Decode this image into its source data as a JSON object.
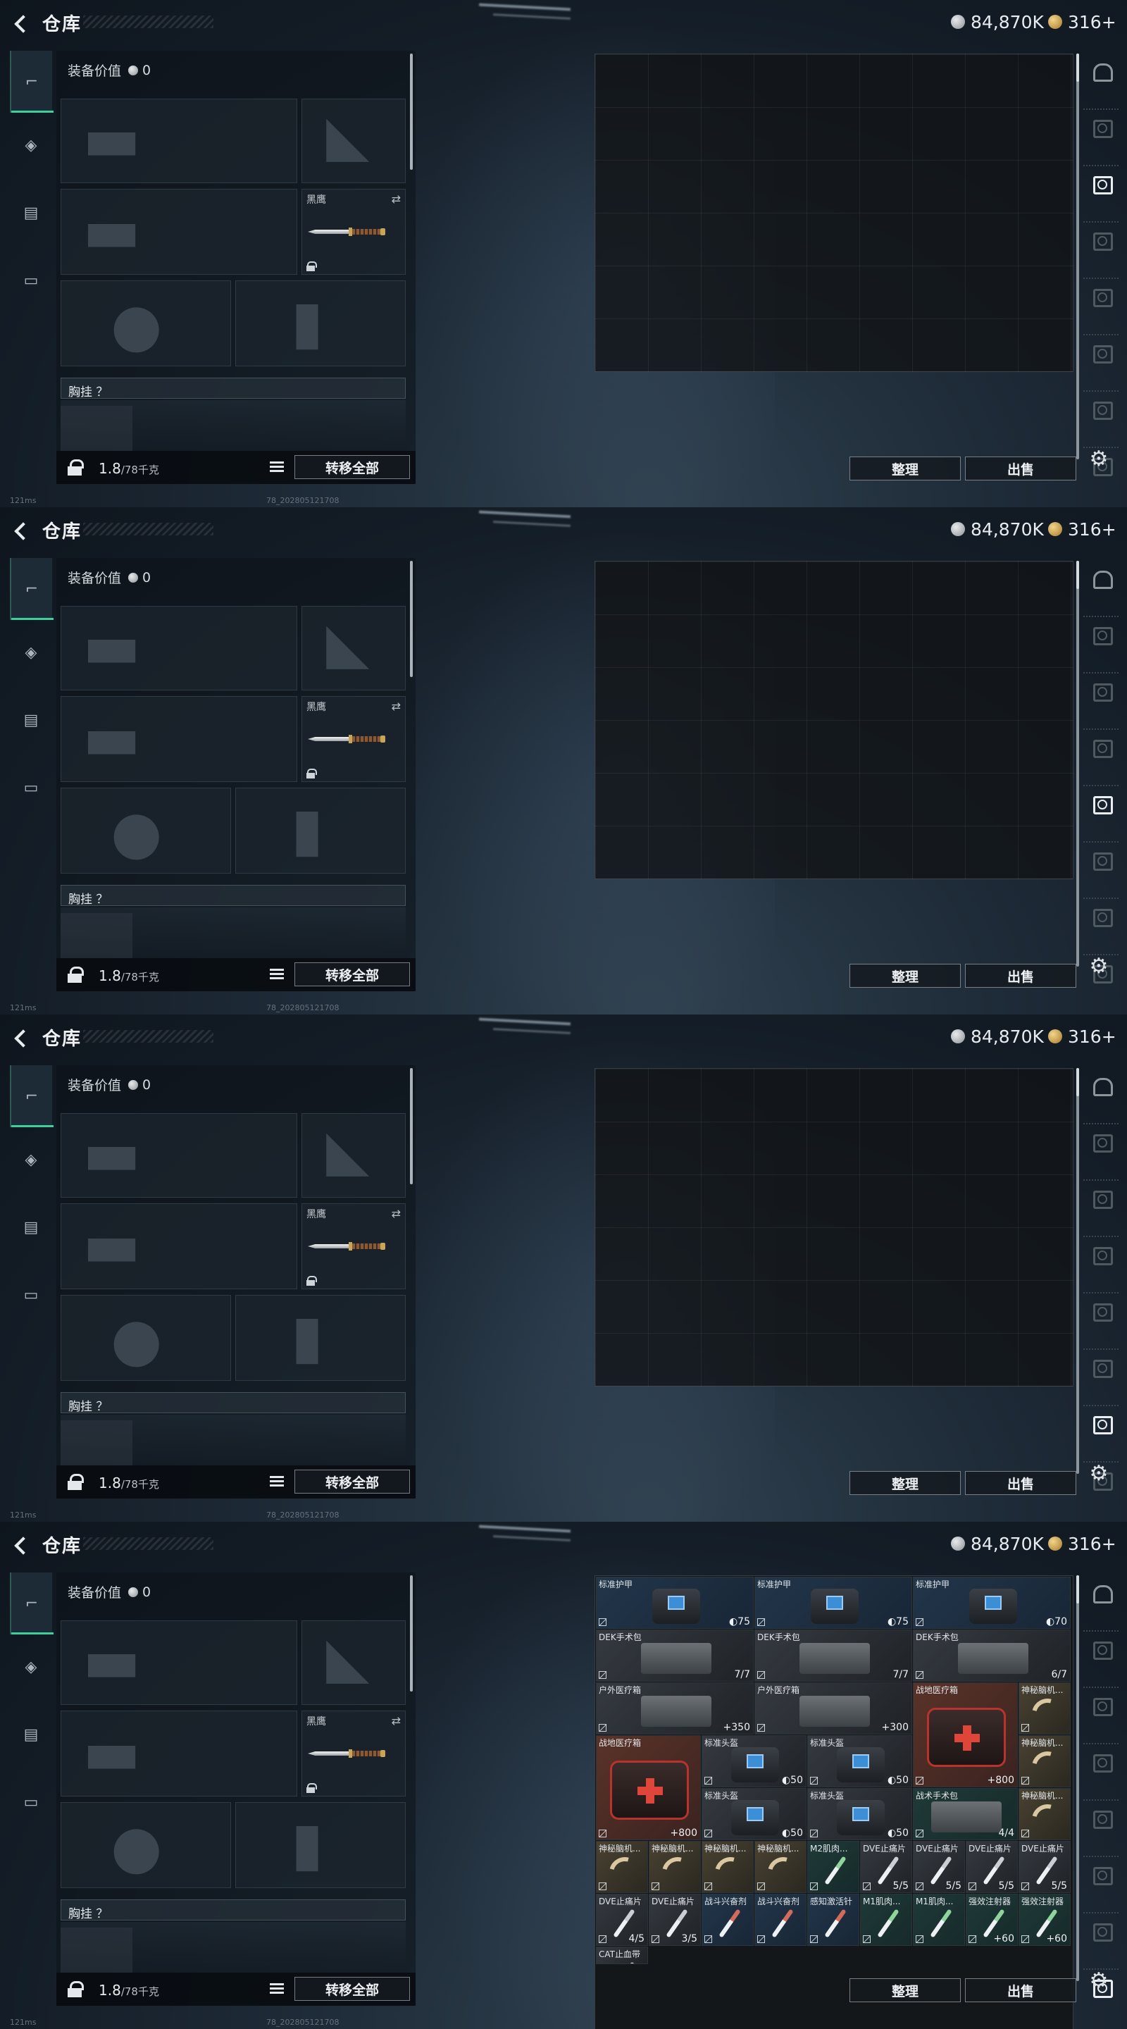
{
  "topbar": {
    "title": "仓库",
    "currency_silver": "84,870K",
    "currency_gold": "316+"
  },
  "equipment": {
    "value_label": "装备价值",
    "value": "0",
    "melee_label": "黑鹰",
    "chest_label": "胸挂 ？",
    "weight_value": "1.8",
    "weight_max": "/78千克",
    "transfer_all": "转移全部"
  },
  "storage": {
    "sort_button": "整理",
    "sell_button": "出售"
  },
  "status": {
    "ping": "121ms",
    "build": "78_202805121708"
  },
  "icons": {
    "back": "back-arrow-icon",
    "tabs": [
      "pistol-icon",
      "backpack-icon",
      "vest-icon",
      "briefcase-icon"
    ],
    "side": [
      "safe-box-icon",
      "storage-tab-icon",
      "settings-gear-icon"
    ]
  },
  "frames": [
    {
      "active_side_tab": 2,
      "items": false
    },
    {
      "active_side_tab": 4,
      "items": false
    },
    {
      "active_side_tab": 6,
      "items": false
    },
    {
      "active_side_tab": 7,
      "items": true
    }
  ],
  "items": [
    {
      "name": "标准护甲",
      "value": "◐75",
      "style": "blu",
      "art": "bag"
    },
    {
      "name": "标准护甲",
      "value": "◐75",
      "style": "blu",
      "art": "bag"
    },
    {
      "name": "标准护甲",
      "value": "◐70",
      "style": "blu",
      "art": "bag"
    },
    {
      "name": "DEK手术包",
      "value": "7/7",
      "style": "dk",
      "art": "case"
    },
    {
      "name": "DEK手术包",
      "value": "7/7",
      "style": "dk",
      "art": "case"
    },
    {
      "name": "DEK手术包",
      "value": "6/7",
      "style": "dk",
      "art": "case"
    },
    {
      "name": "户外医疗箱",
      "value": "+350",
      "style": "dk",
      "art": "case"
    },
    {
      "name": "户外医疗箱",
      "value": "+300",
      "style": "dk",
      "art": "case"
    },
    {
      "name": "战地医疗箱",
      "value": "+800",
      "style": "red",
      "art": "medkit"
    },
    {
      "name": "神秘脑机...",
      "value": "",
      "style": "tan",
      "art": "horn"
    },
    {
      "name": "战地医疗箱",
      "value": "+800",
      "style": "red",
      "art": "medkit"
    },
    {
      "name": "标准头盔",
      "value": "◐50",
      "style": "dk",
      "art": "bag"
    },
    {
      "name": "标准头盔",
      "value": "◐50",
      "style": "dk",
      "art": "bag"
    },
    {
      "name": "神秘脑机...",
      "value": "",
      "style": "tan",
      "art": "horn"
    },
    {
      "name": "标准头盔",
      "value": "◐50",
      "style": "dk",
      "art": "bag"
    },
    {
      "name": "标准头盔",
      "value": "◐50",
      "style": "dk",
      "art": "bag"
    },
    {
      "name": "战术手术包",
      "value": "4/4",
      "style": "grn",
      "art": "case"
    },
    {
      "name": "神秘脑机...",
      "value": "",
      "style": "tan",
      "art": "horn"
    },
    {
      "name": "神秘脑机...",
      "value": "",
      "style": "tan",
      "art": "horn"
    },
    {
      "name": "神秘脑机...",
      "value": "",
      "style": "tan",
      "art": "horn"
    },
    {
      "name": "神秘脑机...",
      "value": "",
      "style": "tan",
      "art": "horn"
    },
    {
      "name": "神秘脑机...",
      "value": "",
      "style": "tan",
      "art": "horn"
    },
    {
      "name": "M2肌肉...",
      "value": "",
      "style": "grn",
      "art": "syr"
    },
    {
      "name": "DVE止痛片",
      "value": "5/5",
      "style": "dk",
      "art": "syr"
    },
    {
      "name": "DVE止痛片",
      "value": "5/5",
      "style": "dk",
      "art": "syr"
    },
    {
      "name": "DVE止痛片",
      "value": "5/5",
      "style": "dk",
      "art": "syr"
    },
    {
      "name": "DVE止痛片",
      "value": "5/5",
      "style": "dk",
      "art": "syr"
    },
    {
      "name": "DVE止痛片",
      "value": "4/5",
      "style": "dk",
      "art": "syr"
    },
    {
      "name": "DVE止痛片",
      "value": "3/5",
      "style": "dk",
      "art": "syr"
    },
    {
      "name": "战斗兴奋剂",
      "value": "",
      "style": "blu",
      "art": "syr"
    },
    {
      "name": "战斗兴奋剂",
      "value": "",
      "style": "blu",
      "art": "syr"
    },
    {
      "name": "感知激活针",
      "value": "",
      "style": "blu",
      "art": "syr"
    },
    {
      "name": "M1肌肉...",
      "value": "",
      "style": "grn",
      "art": "syr"
    },
    {
      "name": "M1肌肉...",
      "value": "",
      "style": "grn",
      "art": "syr"
    },
    {
      "name": "强效注射器",
      "value": "+60",
      "style": "grn",
      "art": "syr"
    },
    {
      "name": "强效注射器",
      "value": "+60",
      "style": "grn",
      "art": "syr"
    },
    {
      "name": "CAT止血带",
      "value": "",
      "style": "dk",
      "art": "syr"
    }
  ]
}
